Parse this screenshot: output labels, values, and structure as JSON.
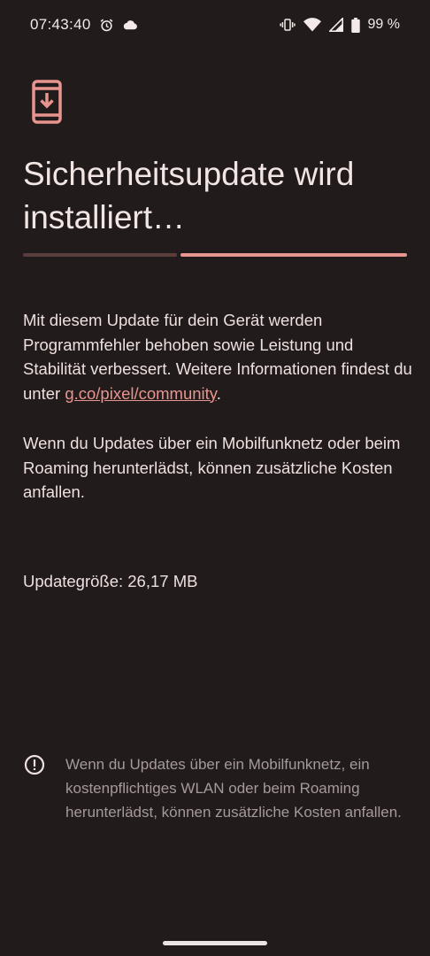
{
  "status_bar": {
    "time": "07:43:40",
    "battery_text": "99 %",
    "icons": [
      "alarm-icon",
      "cloud-icon",
      "vibrate-icon",
      "wifi-icon",
      "cell-signal-icon",
      "battery-icon"
    ]
  },
  "header": {
    "icon": "phone-download-icon",
    "icon_color": "#e8958f",
    "title": "Sicherheitsupdate wird installiert…"
  },
  "progress": {
    "fraction_complete": 0.59,
    "track_color": "#5a3e3c",
    "fill_color": "#e8958f"
  },
  "description": {
    "p1_before_link": "Mit diesem Update für dein Gerät werden Programmfehler behoben sowie Leistung und Stabilität verbessert. Weitere Informationen findest du unter ",
    "p1_link": "g.co/pixel/community",
    "p1_after_link": ".",
    "p2": "Wenn du Updates über ein Mobilfunknetz oder beim Roaming herunterlädst, können zusätzliche Kosten anfallen."
  },
  "update_size": "Updategröße: 26,17 MB",
  "info": {
    "icon": "info-icon",
    "text": "Wenn du Updates über ein Mobilfunknetz, ein kostenpflichtiges WLAN oder beim Roaming herunterlädst, können zusätzliche Kosten anfallen."
  },
  "colors": {
    "background": "#221b1b",
    "accent": "#e8958f"
  }
}
